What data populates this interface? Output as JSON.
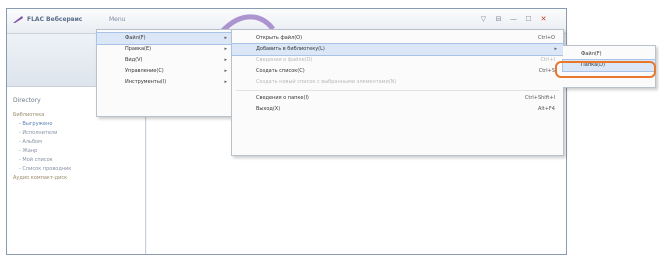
{
  "window": {
    "app_title": "FLAC Вебсервис",
    "menu_button": "Menu",
    "controls": [
      "▽",
      "⊟",
      "—",
      "☐",
      "✕"
    ]
  },
  "sidebar": {
    "header": "Directory",
    "tree": [
      {
        "label": "Библиотека",
        "state": "root"
      },
      {
        "label": "- Выгружено",
        "state": "selected"
      },
      {
        "label": "- Исполнители",
        "state": "normal"
      },
      {
        "label": "- Альбом",
        "state": "normal"
      },
      {
        "label": "- Жанр",
        "state": "normal"
      },
      {
        "label": "- Мой список",
        "state": "normal"
      },
      {
        "label": "- Список проводник",
        "state": "normal"
      },
      {
        "label": "Аудио компакт-диск",
        "state": "root"
      }
    ]
  },
  "main_menu": [
    {
      "label": "Файл(F)",
      "arrow": "▸",
      "highlighted": true
    },
    {
      "label": "Правка(E)",
      "arrow": "▸"
    },
    {
      "label": "Вид(V)",
      "arrow": "▸"
    },
    {
      "label": "Управление(C)",
      "arrow": "▸"
    },
    {
      "label": "Инструменты(I)",
      "arrow": "▸"
    }
  ],
  "file_menu": [
    {
      "label": "Открыть файл(O)",
      "shortcut": "Ctrl+O"
    },
    {
      "label": "Добавить в библиотеку(L)",
      "arrow": "▸",
      "highlighted": true
    },
    {
      "label": "Сведения о файле(D)",
      "shortcut": "Ctrl+I",
      "disabled": true
    },
    {
      "label": "Создать список(C)",
      "shortcut": "Ctrl+S"
    },
    {
      "label": "Создать новый список с выбранными элементами(N)",
      "disabled": true
    },
    {
      "separator": true
    },
    {
      "label": "Сведения о папке(I)",
      "shortcut": "Ctrl+Shift+I"
    },
    {
      "label": "Выход(X)",
      "shortcut": "Alt+F4"
    }
  ],
  "add_submenu": [
    {
      "label": "Файл(F)"
    },
    {
      "label": "Папка(D)",
      "highlighted": true
    }
  ],
  "colors": {
    "accent": "#e8782c",
    "highlight": "#dbe7f6",
    "title": "#5a6e8a"
  }
}
